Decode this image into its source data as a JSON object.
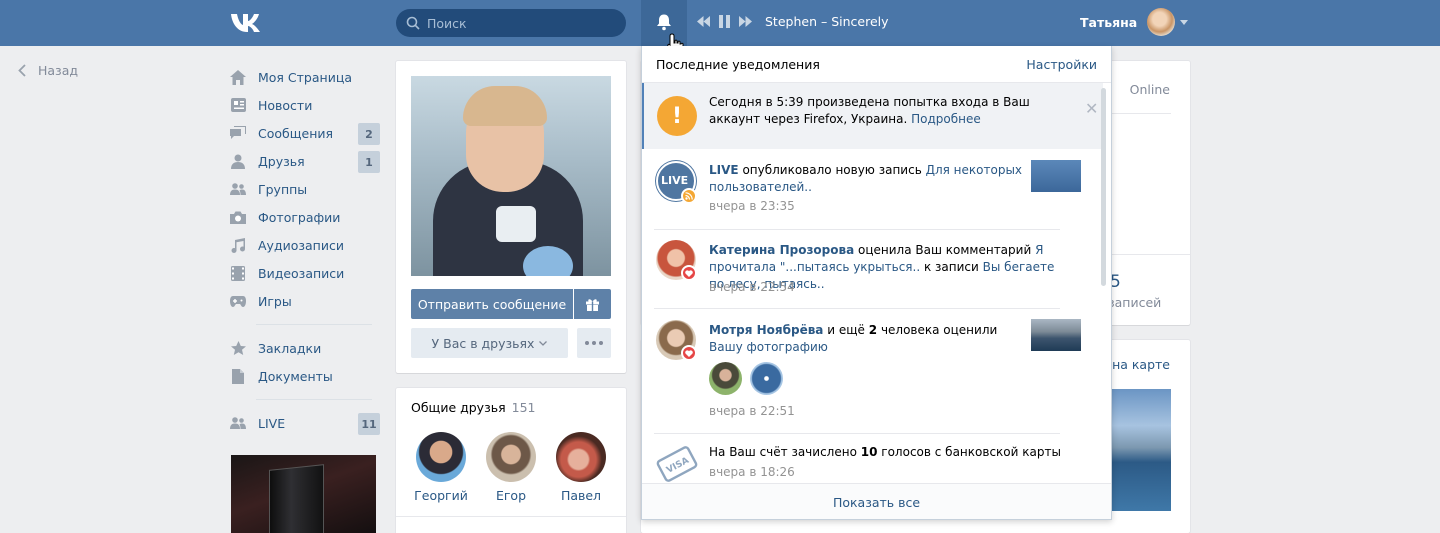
{
  "header": {
    "search_placeholder": "Поиск",
    "track": "Stephen – Sincerely",
    "user_name": "Татьяна"
  },
  "back_label": "Назад",
  "nav": {
    "items": [
      {
        "label": "Моя Страница",
        "icon": "home-icon"
      },
      {
        "label": "Новости",
        "icon": "news-icon"
      },
      {
        "label": "Сообщения",
        "icon": "messages-icon",
        "count": "2"
      },
      {
        "label": "Друзья",
        "icon": "friends-icon",
        "count": "1"
      },
      {
        "label": "Группы",
        "icon": "groups-icon"
      },
      {
        "label": "Фотографии",
        "icon": "camera-icon"
      },
      {
        "label": "Аудиозаписи",
        "icon": "music-icon"
      },
      {
        "label": "Видеозаписи",
        "icon": "video-icon"
      },
      {
        "label": "Игры",
        "icon": "gamepad-icon"
      }
    ],
    "items2": [
      {
        "label": "Закладки",
        "icon": "star-icon"
      },
      {
        "label": "Документы",
        "icon": "document-icon"
      }
    ],
    "items3": [
      {
        "label": "LIVE",
        "icon": "groups-icon",
        "count": "11"
      }
    ]
  },
  "profile": {
    "send_message": "Отправить сообщение",
    "in_friends": "У Вас в друзьях"
  },
  "mutual": {
    "title": "Общие друзья",
    "count": "151",
    "friends": [
      "Георгий",
      "Егор",
      "Павел"
    ]
  },
  "right": {
    "online": "Online",
    "stat_num": "5",
    "stat_label": "записей",
    "map_link": "ь на карте"
  },
  "notifications": {
    "title": "Последние уведомления",
    "settings": "Настройки",
    "warn_text": "Сегодня в 5:39 произведена попытка входа в Ваш аккаунт через Firefox, Украина.",
    "warn_link": "Подробнее",
    "n1_author": "LIVE",
    "n1_text": "опубликовало новую запись",
    "n1_link": "Для некоторых пользователей..",
    "n1_time": "вчера в 23:35",
    "n2_author": "Катерина Прозорова",
    "n2_text": "оценила Ваш комментарий",
    "n2_link1": "Я прочитала \"...пытаясь укрыться..",
    "n2_text2": "к записи",
    "n2_link2": "Вы бегаете по лесу, пытаясь..",
    "n2_time": "вчера в 22:54",
    "n3_author": "Мотря Ноябрёва",
    "n3_text1": "и ещё",
    "n3_count": "2",
    "n3_text2": "человека оценили",
    "n3_link": "Вашу фотографию",
    "n3_time": "вчера в 22:51",
    "n4_text1": "На Ваш счёт зачислено",
    "n4_count": "10",
    "n4_text2": "голосов с банковской карты",
    "n4_time": "вчера в 18:26",
    "show_all": "Показать все",
    "live_icon_text": "LIVE",
    "visa_text": "VISA"
  }
}
